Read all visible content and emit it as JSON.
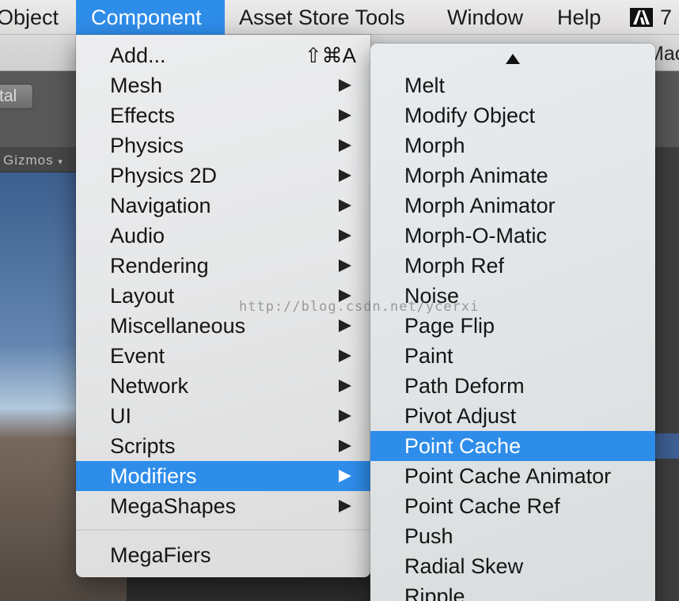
{
  "menubar": {
    "items": [
      "Object",
      "Component",
      "Asset Store Tools",
      "Window",
      "Help"
    ],
    "active": "Component",
    "extra_label": "7",
    "adobe_icon": "adobe-icon"
  },
  "editor": {
    "toolbar_button": "tal",
    "gizmos_label": "Gizmos",
    "corner_label": "Mac"
  },
  "component_menu": {
    "items": [
      {
        "label": "Add...",
        "shortcut": "⇧⌘A",
        "submenu": false
      },
      {
        "label": "Mesh",
        "submenu": true
      },
      {
        "label": "Effects",
        "submenu": true
      },
      {
        "label": "Physics",
        "submenu": true
      },
      {
        "label": "Physics 2D",
        "submenu": true
      },
      {
        "label": "Navigation",
        "submenu": true
      },
      {
        "label": "Audio",
        "submenu": true
      },
      {
        "label": "Rendering",
        "submenu": true
      },
      {
        "label": "Layout",
        "submenu": true
      },
      {
        "label": "Miscellaneous",
        "submenu": true
      },
      {
        "label": "Event",
        "submenu": true
      },
      {
        "label": "Network",
        "submenu": true
      },
      {
        "label": "UI",
        "submenu": true
      },
      {
        "label": "Scripts",
        "submenu": true
      },
      {
        "label": "Modifiers",
        "submenu": true,
        "selected": true
      },
      {
        "label": "MegaShapes",
        "submenu": true
      }
    ],
    "footer_item": "MegaFiers"
  },
  "modifiers_submenu": {
    "scroll_icon": "scroll-up-arrow",
    "items": [
      "Melt",
      "Modify Object",
      "Morph",
      "Morph Animate",
      "Morph Animator",
      "Morph-O-Matic",
      "Morph Ref",
      "Noise",
      "Page Flip",
      "Paint",
      "Path Deform",
      "Pivot Adjust",
      "Point Cache",
      "Point Cache Animator",
      "Point Cache Ref",
      "Push",
      "Radial Skew",
      "Ripple"
    ],
    "selected": "Point Cache"
  },
  "watermark": "http://blog.csdn.net/ycerxi",
  "colors": {
    "selection": "#2f8dea",
    "menu_bg": "#e8e9ea"
  }
}
